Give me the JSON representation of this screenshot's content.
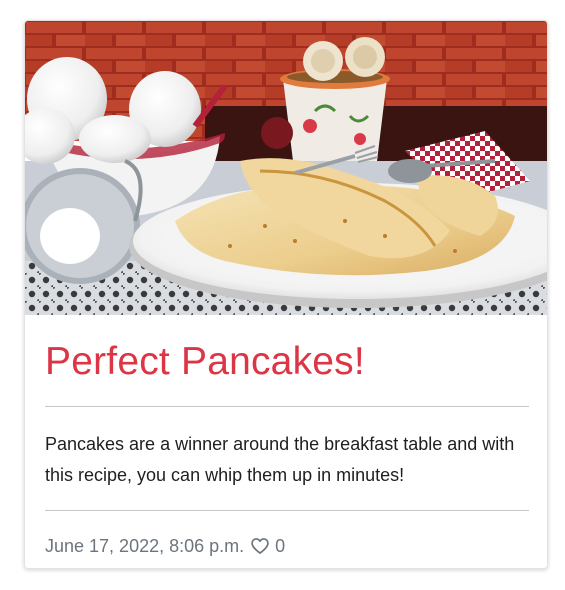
{
  "post": {
    "title": "Perfect Pancakes!",
    "excerpt": "Pancakes are a winner around the breakfast table and with this recipe, you can whip them up in minutes!",
    "date": "June 17, 2022, 8:06 p.m.",
    "likes": "0"
  },
  "colors": {
    "title": "#dc3545",
    "meta": "#6c757d",
    "text": "#1f1f1f"
  },
  "icons": {
    "like": "heart-outline-icon"
  }
}
